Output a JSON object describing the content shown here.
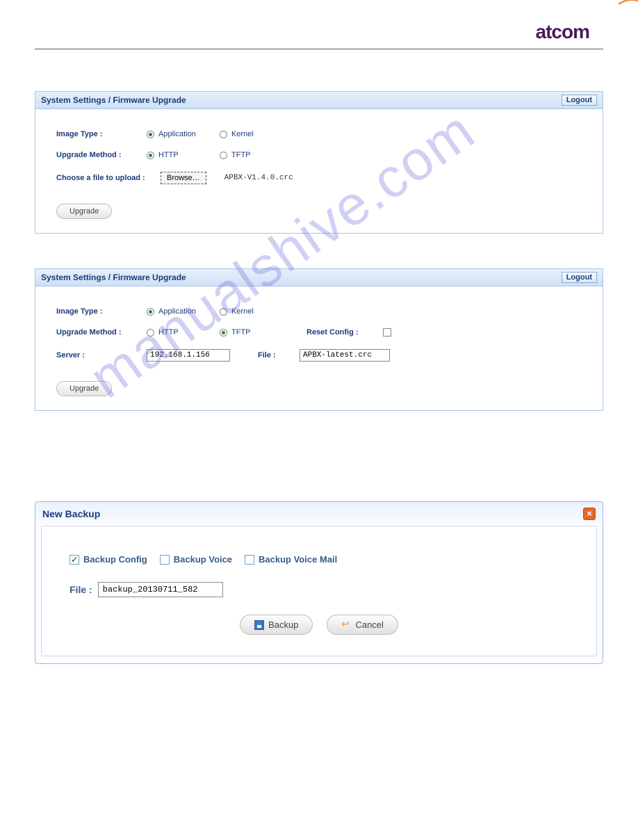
{
  "brand": "atcom",
  "watermark": "manualshive.com",
  "panel1": {
    "title": "System Settings / Firmware Upgrade",
    "logout": "Logout",
    "labels": {
      "image_type": "Image Type :",
      "upgrade_method": "Upgrade Method :",
      "choose_file": "Choose a file to upload :"
    },
    "radios": {
      "application": "Application",
      "kernel": "Kernel",
      "http": "HTTP",
      "tftp": "TFTP"
    },
    "browse": "Browse…",
    "filename": "APBX-V1.4.0.crc",
    "upgrade_btn": "Upgrade"
  },
  "panel2": {
    "title": "System Settings / Firmware Upgrade",
    "logout": "Logout",
    "labels": {
      "image_type": "Image Type :",
      "upgrade_method": "Upgrade Method :",
      "server": "Server :",
      "file": "File :",
      "reset_config": "Reset Config :"
    },
    "radios": {
      "application": "Application",
      "kernel": "Kernel",
      "http": "HTTP",
      "tftp": "TFTP"
    },
    "server_value": "192.168.1.156",
    "file_value": "APBX-latest.crc",
    "upgrade_btn": "Upgrade"
  },
  "dialog": {
    "title": "New Backup",
    "close": "×",
    "checks": {
      "config": "Backup Config",
      "voice": "Backup Voice",
      "voicemail": "Backup Voice Mail"
    },
    "file_label": "File :",
    "file_value": "backup_20130711_582",
    "backup_btn": "Backup",
    "cancel_btn": "Cancel"
  }
}
